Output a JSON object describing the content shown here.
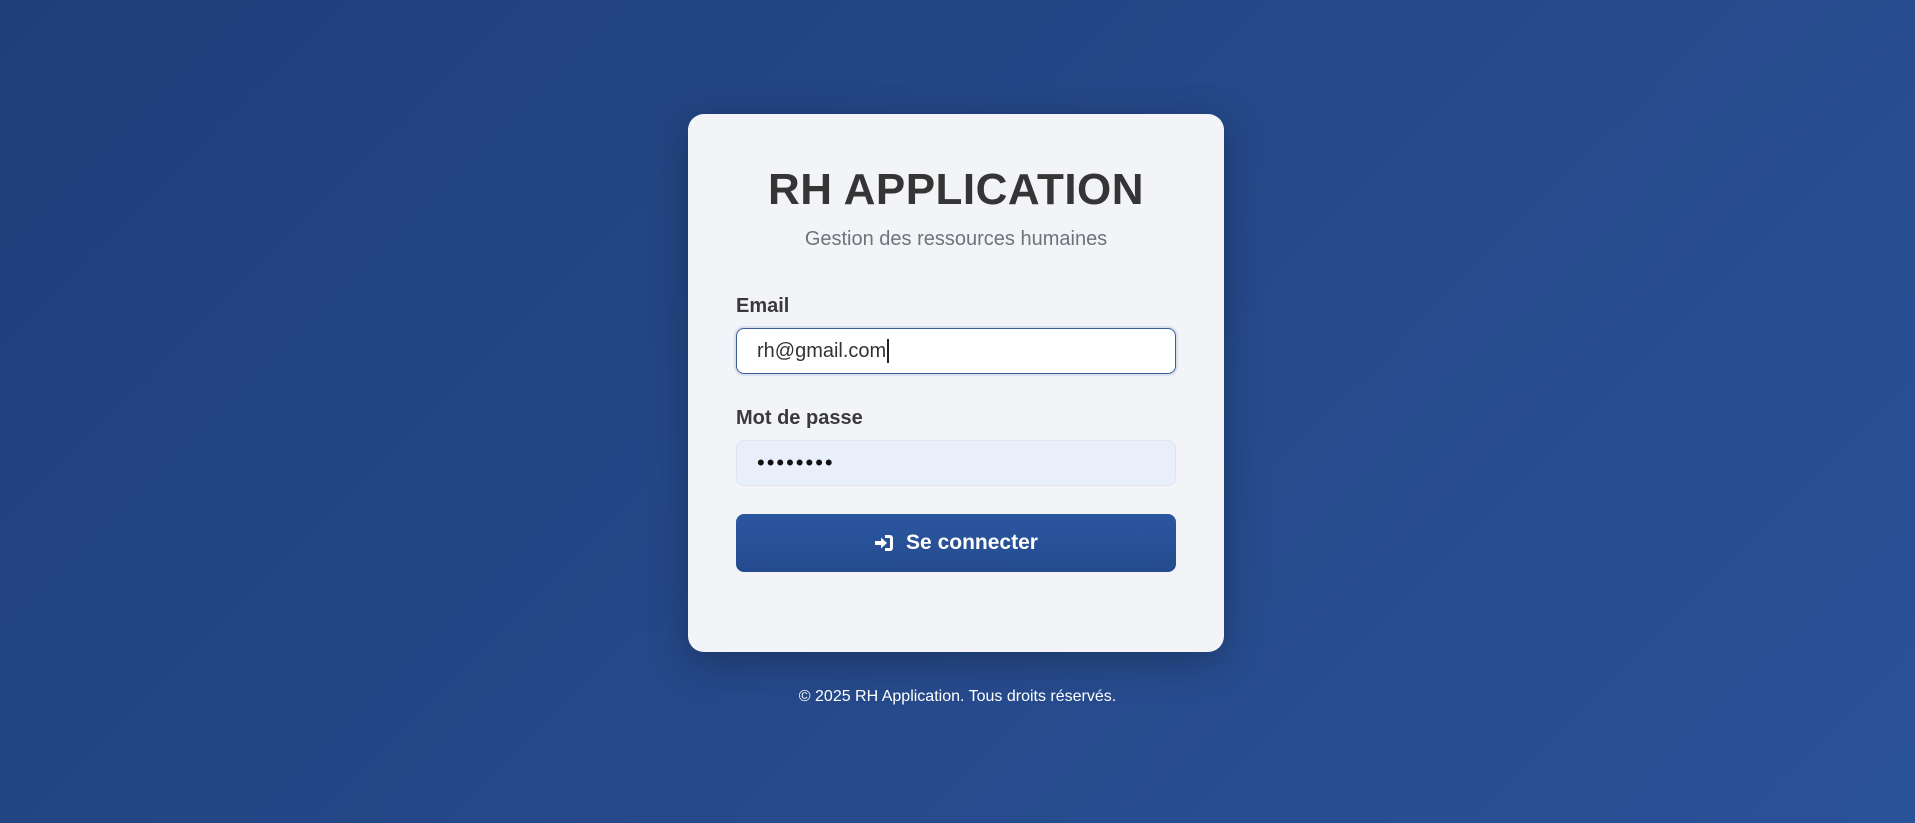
{
  "app": {
    "title": "RH APPLICATION",
    "subtitle": "Gestion des ressources humaines"
  },
  "form": {
    "email_label": "Email",
    "email_value": "rh@gmail.com",
    "password_label": "Mot de passe",
    "password_value": "••••••••",
    "submit_label": "Se connecter",
    "submit_icon": "sign-in-icon"
  },
  "footer": {
    "text": "© 2025 RH Application. Tous droits réservés."
  },
  "colors": {
    "background": "#26498a",
    "card": "#f2f4f8",
    "primary_button": "#2b56a0",
    "password_field_bg": "#e8eefa"
  }
}
